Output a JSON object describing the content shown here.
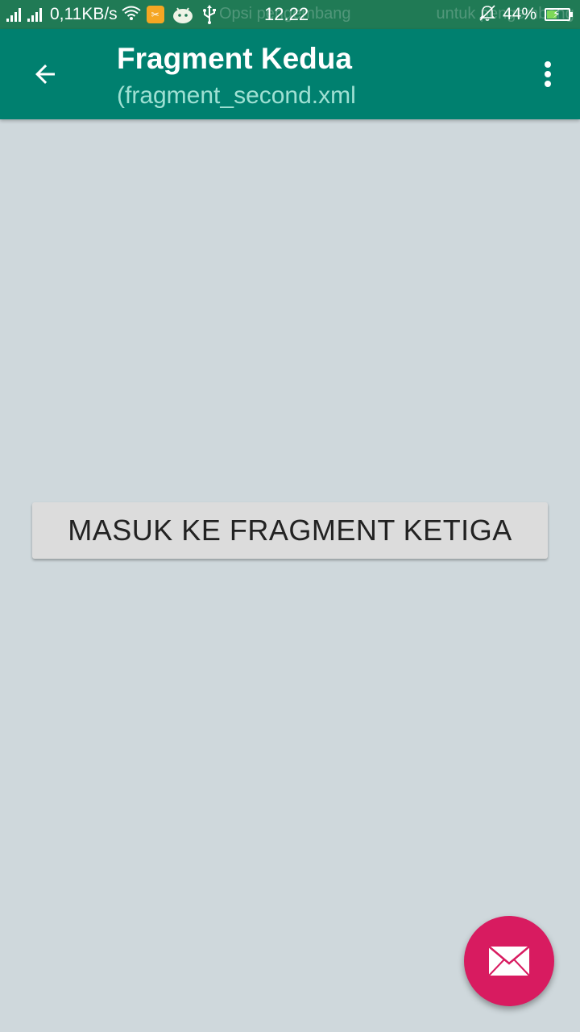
{
  "status_bar": {
    "network_speed": "0,11KB/s",
    "time": "12.22",
    "battery_percent": "44%",
    "battery_level": 0.44,
    "notification_ghost_left": "Opsi pengembang",
    "notification_ghost_right": "untuk pengembang",
    "icons": [
      "signal-icon",
      "signal-icon",
      "wifi-icon",
      "app-notification-icon",
      "android-icon",
      "usb-icon",
      "silent-bell-icon",
      "battery-charging-icon"
    ]
  },
  "app_bar": {
    "title": "Fragment Kedua",
    "subtitle": "(fragment_second.xml",
    "back_icon": "arrow-back-icon",
    "menu_icon": "more-vert-icon",
    "color": "#00806f"
  },
  "main": {
    "button_label": "MASUK KE FRAGMENT KETIGA",
    "background": "#cfd8dc"
  },
  "fab": {
    "icon": "email-icon",
    "color": "#d81b60"
  }
}
